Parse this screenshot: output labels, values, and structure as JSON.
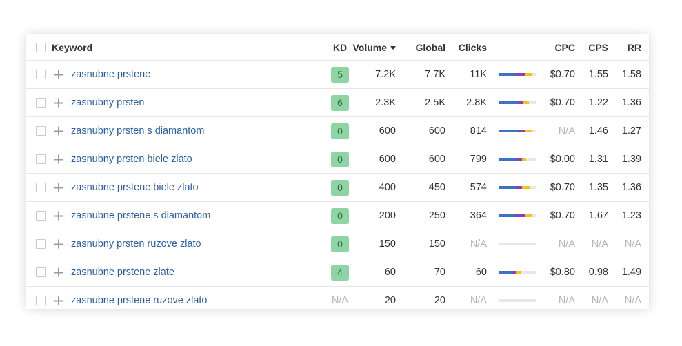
{
  "colors": {
    "kd_green": "#8fd4a3",
    "link": "#2a5fa8",
    "bar_blue": "#3c73c5",
    "bar_purple": "#8a3fbf",
    "bar_yellow": "#f2c319",
    "bar_track": "#e8e8e8"
  },
  "header": {
    "keyword": "Keyword",
    "kd": "KD",
    "volume": "Volume",
    "global": "Global",
    "clicks": "Clicks",
    "cpc": "CPC",
    "cps": "CPS",
    "rr": "RR"
  },
  "rows": [
    {
      "keyword": "zasnubne prstene",
      "kd": "5",
      "volume": "7.2K",
      "global": "7.7K",
      "clicks": "11K",
      "cpc": "$0.70",
      "cps": "1.55",
      "rr": "1.58",
      "clicks_split": [
        0.48,
        0.22,
        0.18
      ]
    },
    {
      "keyword": "zasnubny prsten",
      "kd": "6",
      "volume": "2.3K",
      "global": "2.5K",
      "clicks": "2.8K",
      "cpc": "$0.70",
      "cps": "1.22",
      "rr": "1.36",
      "clicks_split": [
        0.5,
        0.16,
        0.14
      ]
    },
    {
      "keyword": "zasnubny prsten s diamantom",
      "kd": "0",
      "volume": "600",
      "global": "600",
      "clicks": "814",
      "cpc": "N/A",
      "cps": "1.46",
      "rr": "1.27",
      "clicks_split": [
        0.5,
        0.2,
        0.18
      ]
    },
    {
      "keyword": "zasnubny prsten biele zlato",
      "kd": "0",
      "volume": "600",
      "global": "600",
      "clicks": "799",
      "cpc": "$0.00",
      "cps": "1.31",
      "rr": "1.39",
      "clicks_split": [
        0.48,
        0.14,
        0.1
      ]
    },
    {
      "keyword": "zasnubne prstene biele zlato",
      "kd": "0",
      "volume": "400",
      "global": "450",
      "clicks": "574",
      "cpc": "$0.70",
      "cps": "1.35",
      "rr": "1.36",
      "clicks_split": [
        0.46,
        0.16,
        0.2
      ]
    },
    {
      "keyword": "zasnubne prstene s diamantom",
      "kd": "0",
      "volume": "200",
      "global": "250",
      "clicks": "364",
      "cpc": "$0.70",
      "cps": "1.67",
      "rr": "1.23",
      "clicks_split": [
        0.44,
        0.26,
        0.18
      ]
    },
    {
      "keyword": "zasnubny prsten ruzove zlato",
      "kd": "0",
      "volume": "150",
      "global": "150",
      "clicks": "N/A",
      "cpc": "N/A",
      "cps": "N/A",
      "rr": "N/A",
      "clicks_split": [
        0,
        0,
        0
      ]
    },
    {
      "keyword": "zasnubne prstene zlate",
      "kd": "4",
      "volume": "60",
      "global": "70",
      "clicks": "60",
      "cpc": "$0.80",
      "cps": "0.98",
      "rr": "1.49",
      "clicks_split": [
        0.36,
        0.12,
        0.1
      ]
    },
    {
      "keyword": "zasnubne prstene ruzove zlato",
      "kd": "N/A",
      "volume": "20",
      "global": "20",
      "clicks": "N/A",
      "cpc": "N/A",
      "cps": "N/A",
      "rr": "N/A",
      "clicks_split": [
        0,
        0,
        0
      ]
    }
  ]
}
